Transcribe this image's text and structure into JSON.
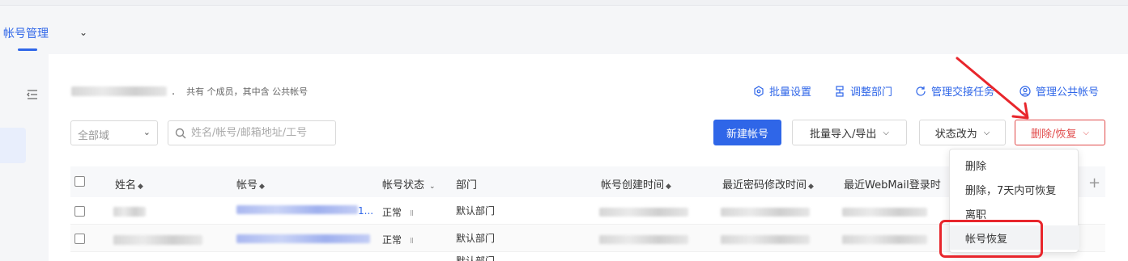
{
  "subnav": {
    "tab_label": "帐号管理",
    "chevron_icon": "chevron-down-icon"
  },
  "summary": {
    "dot": ".",
    "info": "共有 个成员，其中含 公共帐号"
  },
  "actions": [
    {
      "label": "批量设置",
      "icon": "hexagon-settings-icon"
    },
    {
      "label": "调整部门",
      "icon": "dept-icon"
    },
    {
      "label": "管理交接任务",
      "icon": "refresh-icon"
    },
    {
      "label": "管理公共帐号",
      "icon": "user-icon"
    }
  ],
  "filters": {
    "domain_label": "全部域",
    "search_placeholder": "姓名/帐号/邮箱地址/工号"
  },
  "toolbar": {
    "new_account": "新建帐号",
    "import_export": "批量导入/导出",
    "change_status": "状态改为",
    "delete_restore": "删除/恢复"
  },
  "table": {
    "headers": {
      "name": "姓名",
      "account": "帐号",
      "status": "帐号状态",
      "dept": "部门",
      "created": "帐号创建时间",
      "pwd_changed": "最近密码修改时间",
      "webmail_login": "最近WebMail登录时"
    },
    "rows": [
      {
        "account_suffix": "1...",
        "status": "正常",
        "dept": "默认部门"
      },
      {
        "status": "正常",
        "dept": "默认部门"
      }
    ],
    "partial_row_dept": "默认部门"
  },
  "dropdown": {
    "items": [
      {
        "label": "删除"
      },
      {
        "label": "删除，7天内可恢复"
      },
      {
        "label": "离职"
      },
      {
        "label": "帐号恢复"
      }
    ]
  },
  "colors": {
    "accent": "#2f66e8",
    "danger": "#e14b4b",
    "annotation": "#e8262c"
  }
}
